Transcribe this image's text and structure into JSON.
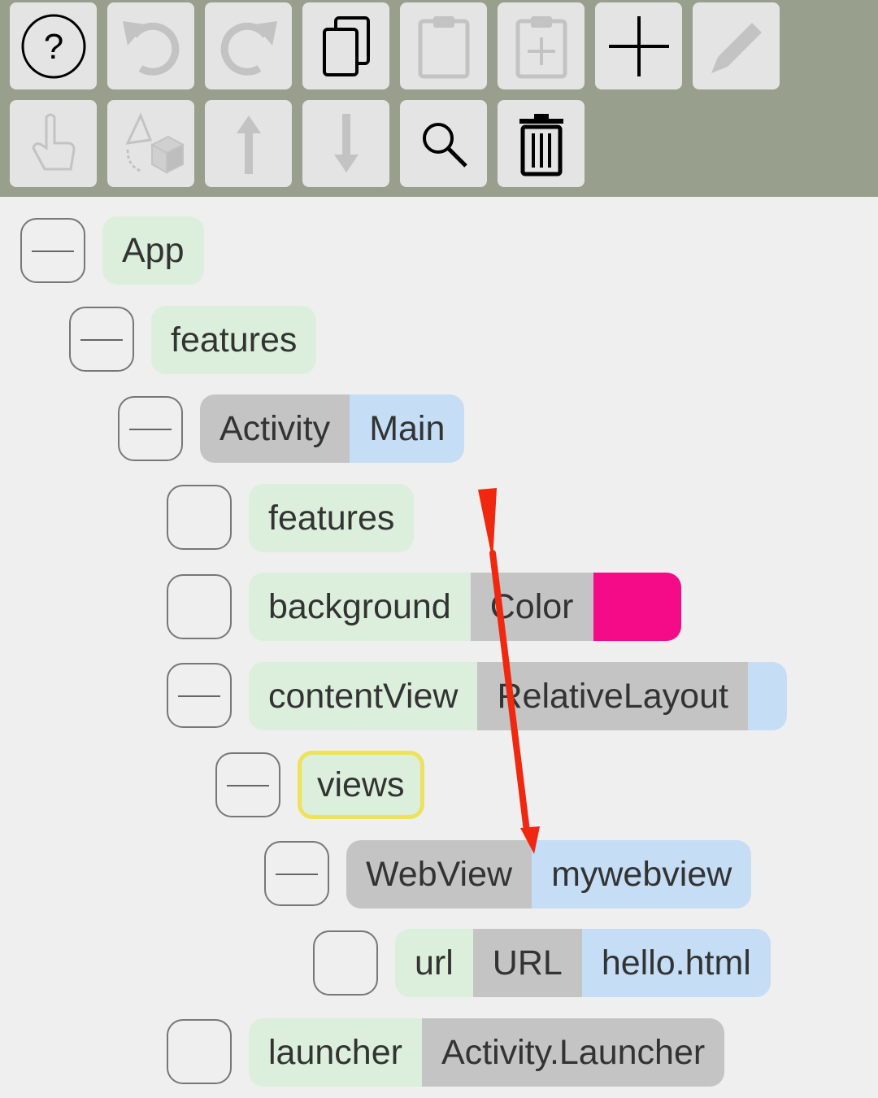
{
  "toolbar": {
    "row1": [
      {
        "icon": "help-icon",
        "enabled": true
      },
      {
        "icon": "undo-icon",
        "enabled": false
      },
      {
        "icon": "redo-icon",
        "enabled": false
      },
      {
        "icon": "copy-icon",
        "enabled": true
      },
      {
        "icon": "paste-icon",
        "enabled": false
      },
      {
        "icon": "paste-add-icon",
        "enabled": false
      },
      {
        "icon": "add-icon",
        "enabled": true
      },
      {
        "icon": "edit-icon",
        "enabled": false
      }
    ],
    "row2": [
      {
        "icon": "pointer-icon",
        "enabled": false
      },
      {
        "icon": "transform-object-icon",
        "enabled": false
      },
      {
        "icon": "arrow-up-icon",
        "enabled": false
      },
      {
        "icon": "arrow-down-icon",
        "enabled": false
      },
      {
        "icon": "search-icon",
        "enabled": true
      },
      {
        "icon": "trash-icon",
        "enabled": true
      }
    ]
  },
  "tree": {
    "app": {
      "name": "App"
    },
    "features": {
      "name": "features"
    },
    "activity": {
      "type": "Activity",
      "name": "Main"
    },
    "activity_features": {
      "name": "features"
    },
    "background": {
      "name": "background",
      "type": "Color",
      "swatch": "#f50a87"
    },
    "content_view": {
      "name": "contentView",
      "type": "RelativeLayout"
    },
    "views": {
      "name": "views"
    },
    "webview": {
      "type": "WebView",
      "name": "mywebview"
    },
    "url": {
      "name": "url",
      "type": "URL",
      "value": "hello.html"
    },
    "launcher": {
      "name": "launcher",
      "type": "Activity.Launcher"
    }
  },
  "colors": {
    "toolbar_bg": "#989f8d",
    "field_green": "#dcefdc",
    "type_gray": "#c4c4c4",
    "value_blue": "#c5ddf5",
    "selection_yellow": "#ede25a",
    "annotation_arrow": "#f0280f"
  }
}
